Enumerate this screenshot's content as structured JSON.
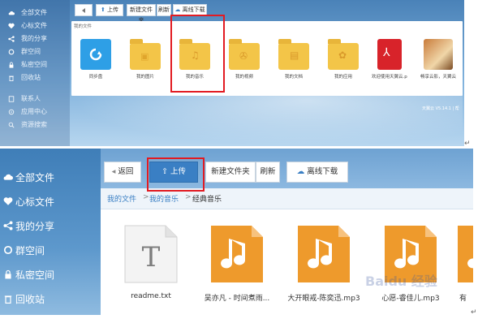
{
  "top": {
    "sidebar": [
      {
        "label": "全部文件",
        "icon": "cloud-icon"
      },
      {
        "label": "心标文件",
        "icon": "heart-icon"
      },
      {
        "label": "我的分享",
        "icon": "share-icon"
      },
      {
        "label": "群空间",
        "icon": "group-icon"
      },
      {
        "label": "私密空间",
        "icon": "lock-icon"
      },
      {
        "label": "回收站",
        "icon": "trash-icon"
      },
      {
        "label": "联系人",
        "icon": "contacts-icon"
      },
      {
        "label": "应用中心",
        "icon": "apps-icon"
      },
      {
        "label": "资源搜索",
        "icon": "search-icon"
      }
    ],
    "toolbar": {
      "upload": "上传",
      "new_folder": "新建文件夹",
      "refresh": "刷新",
      "offline": "离线下载"
    },
    "breadcrumb": "我的文件",
    "files": [
      {
        "name": "同步盘",
        "kind": "sync"
      },
      {
        "name": "我的图片",
        "kind": "folder"
      },
      {
        "name": "我的音乐",
        "kind": "folder"
      },
      {
        "name": "我的视频",
        "kind": "folder"
      },
      {
        "name": "我的文档",
        "kind": "folder"
      },
      {
        "name": "我的应用",
        "kind": "folder"
      },
      {
        "name": "欢迎使用天翼云.pdf",
        "kind": "pdf"
      },
      {
        "name": "畅享云影，天翼云...",
        "kind": "image"
      }
    ],
    "version": "天翼云 V5.14.1 | 帮"
  },
  "bottom": {
    "sidebar": [
      {
        "label": "全部文件",
        "icon": "cloud-icon"
      },
      {
        "label": "心标文件",
        "icon": "heart-icon"
      },
      {
        "label": "我的分享",
        "icon": "share-icon"
      },
      {
        "label": "群空间",
        "icon": "group-icon"
      },
      {
        "label": "私密空间",
        "icon": "lock-icon"
      },
      {
        "label": "回收站",
        "icon": "trash-icon"
      }
    ],
    "toolbar": {
      "back": "返回",
      "upload": "上传",
      "new_folder": "新建文件夹",
      "refresh": "刷新",
      "offline": "离线下载"
    },
    "breadcrumb": {
      "crumb1": "我的文件",
      "sep1": ">",
      "crumb2": "我的音乐",
      "sep2": ">",
      "current": "经典音乐"
    },
    "files": [
      {
        "name": "readme.txt",
        "kind": "txt"
      },
      {
        "name": "吴亦凡 - 时间煮雨...",
        "kind": "music"
      },
      {
        "name": "大开眼戒-陈奕迅.mp3",
        "kind": "music"
      },
      {
        "name": "心愿-睿佳儿.mp3",
        "kind": "music"
      },
      {
        "name": "有",
        "kind": "music"
      }
    ],
    "watermark": "Baidu 经验"
  },
  "colors": {
    "highlight": "#e21b22",
    "folder": "#f3c548",
    "music": "#ee9a2c",
    "upload_btn": "#3a7fc4"
  }
}
